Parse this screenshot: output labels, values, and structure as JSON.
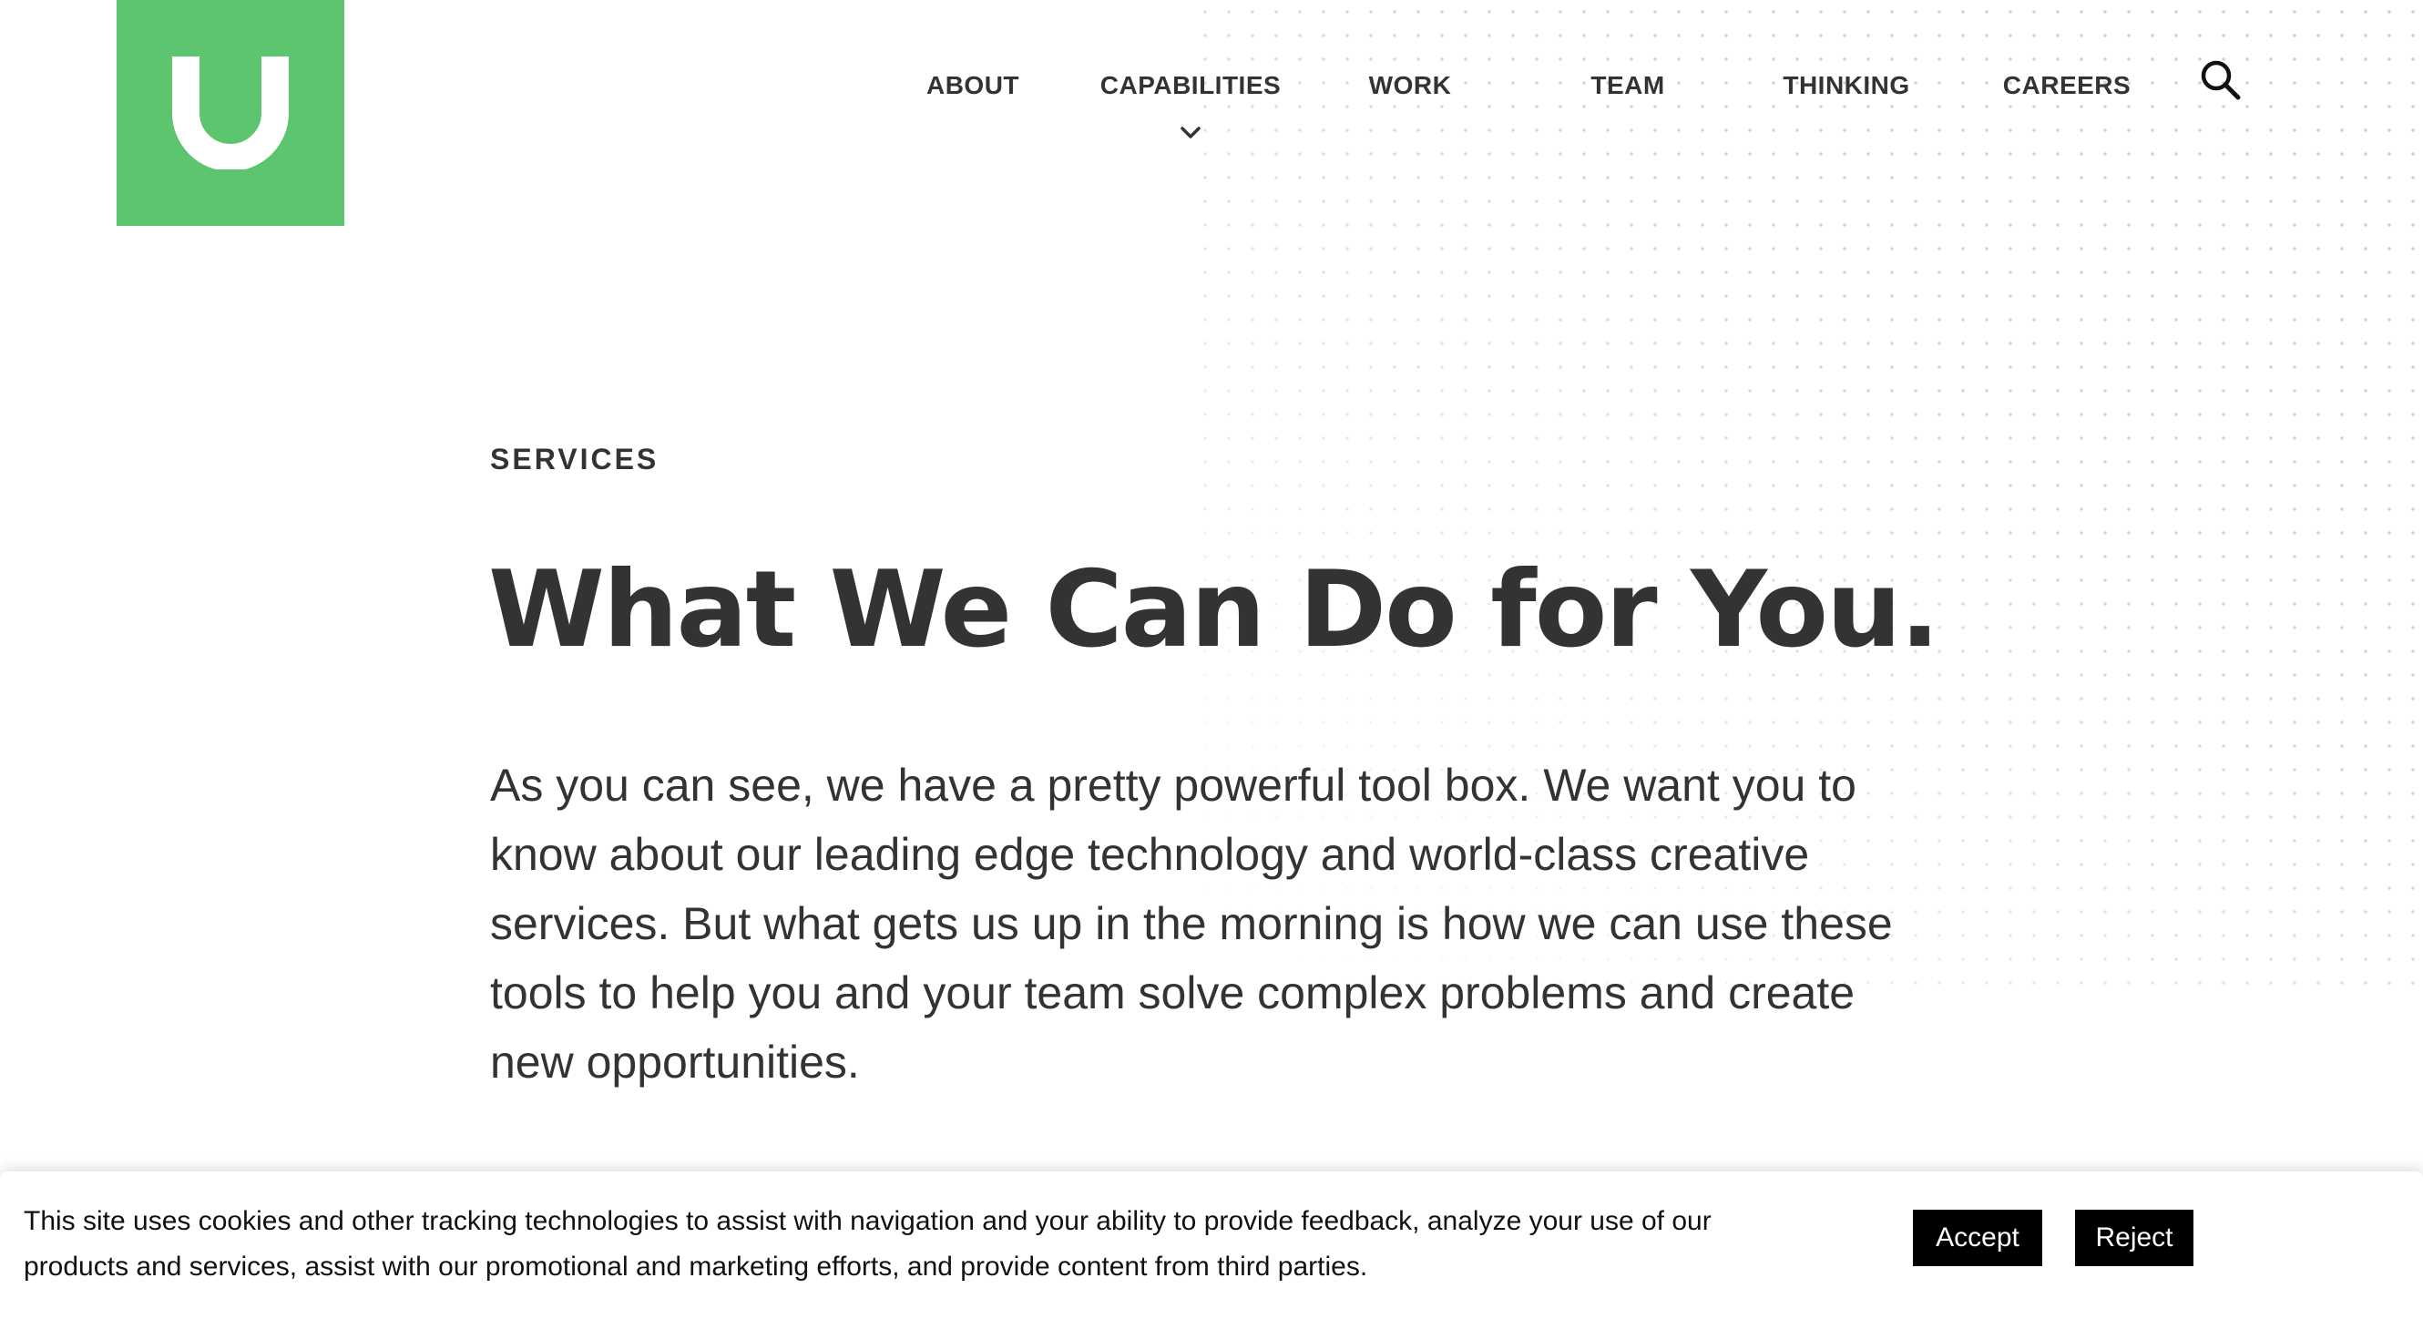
{
  "brand": {
    "logo_letter": "U",
    "accent_color": "#5dc56f"
  },
  "nav": {
    "items": [
      {
        "label": "ABOUT"
      },
      {
        "label": "CAPABILITIES",
        "has_dropdown": true
      },
      {
        "label": "WORK"
      },
      {
        "label": "TEAM"
      },
      {
        "label": "THINKING"
      },
      {
        "label": "CAREERS"
      }
    ],
    "search_icon": "search-icon",
    "dropdown_icon": "chevron-down-icon"
  },
  "hero": {
    "eyebrow": "SERVICES",
    "headline": "What We Can Do for You.",
    "body": "As you can see, we have a pretty powerful tool box. We want you to know about our leading edge technology and world-class creative services. But what gets us up in the morning is how we can use these tools to help you and your team solve complex problems and create new opportunities."
  },
  "cookie_banner": {
    "text": "This site uses cookies and other tracking technologies to assist with navigation and your ability to provide feedback, analyze your use of our products and services, assist with our promotional and marketing efforts, and provide content from third parties.",
    "accept_label": "Accept",
    "reject_label": "Reject"
  }
}
